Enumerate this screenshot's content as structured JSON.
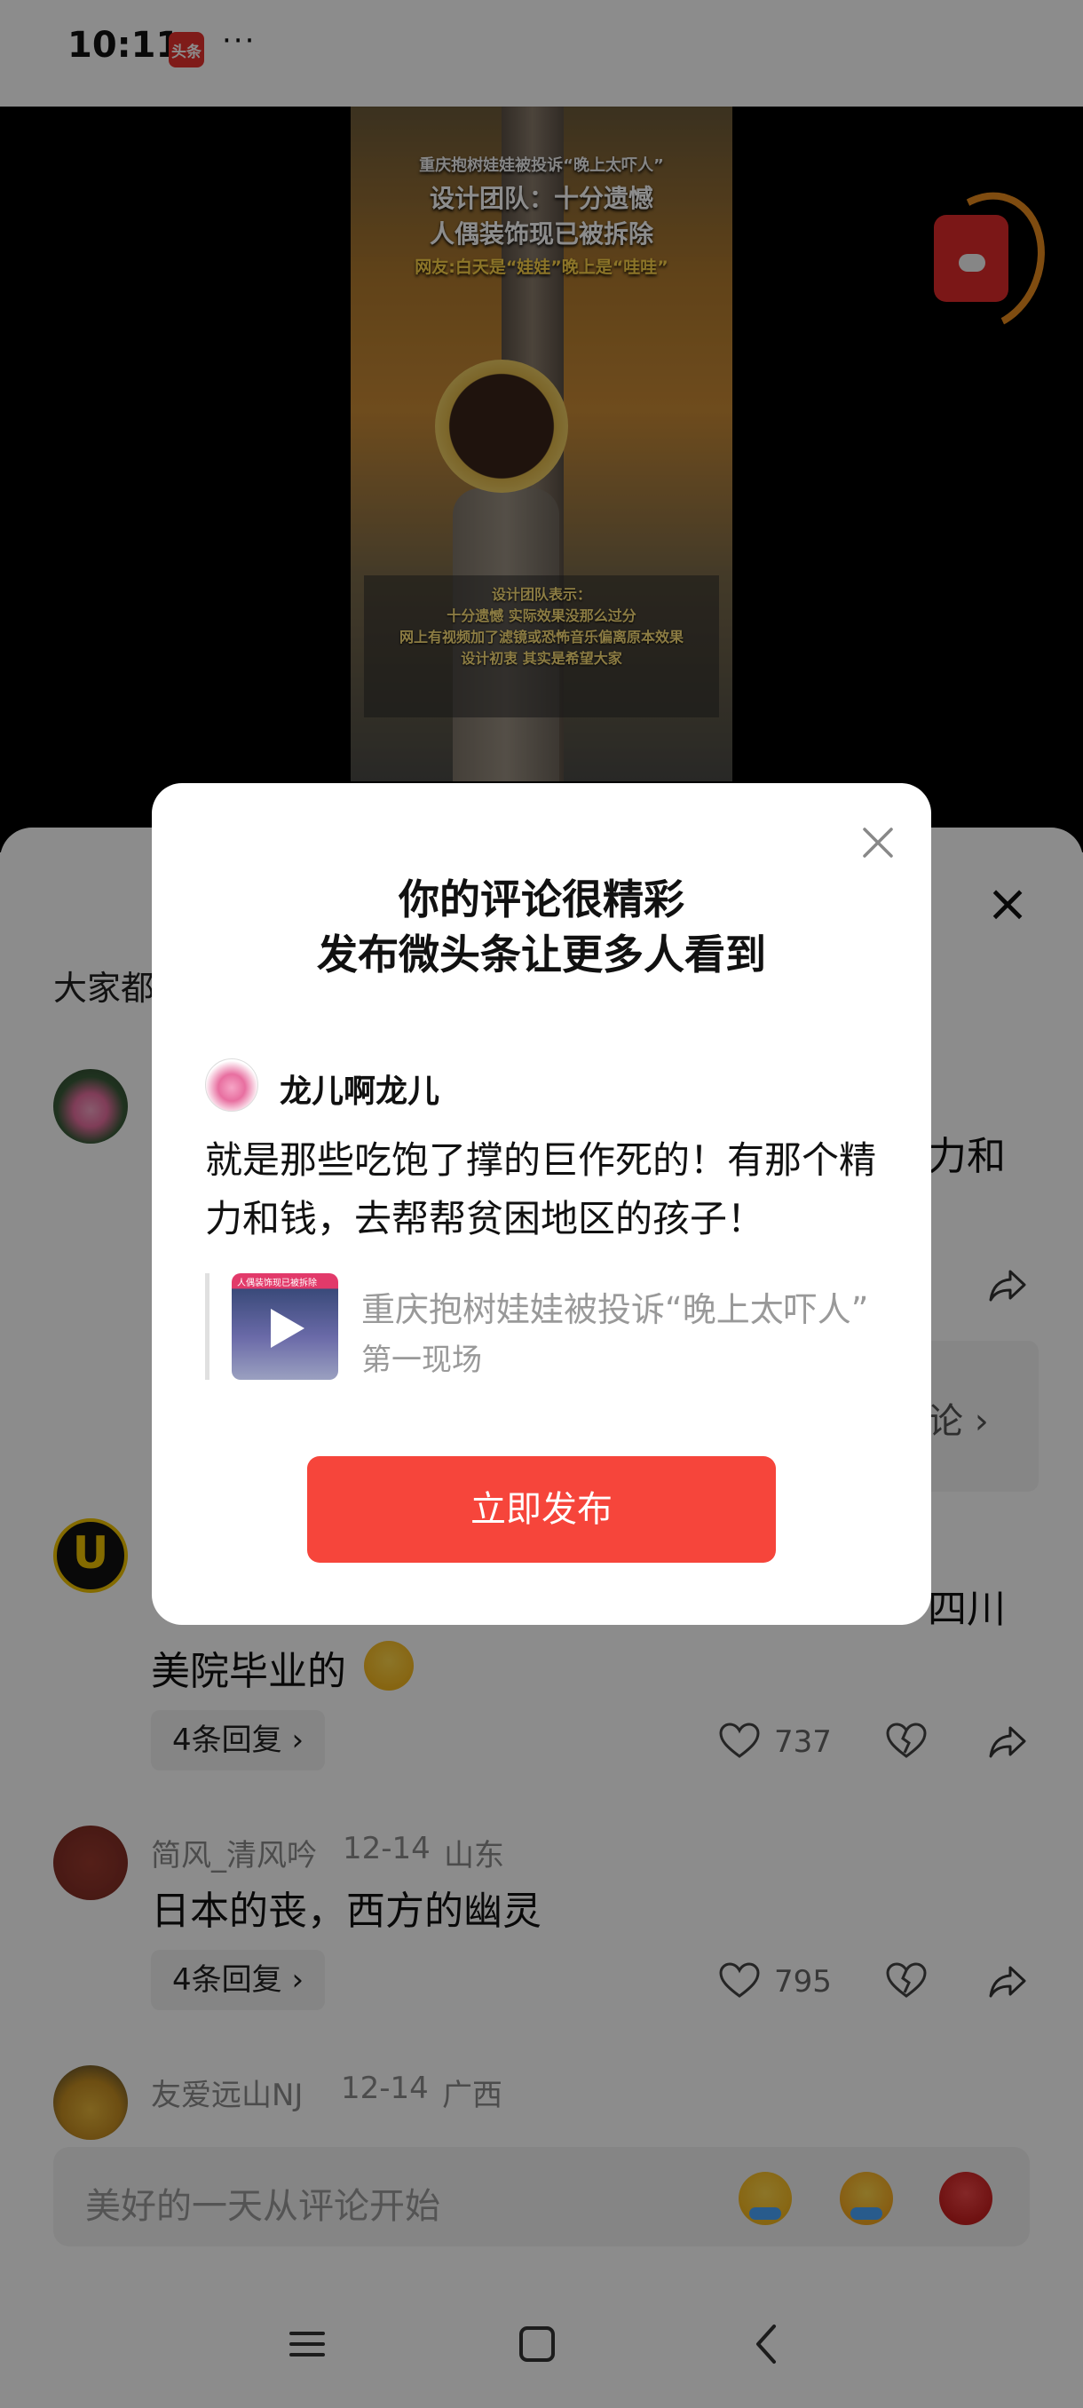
{
  "status_bar": {
    "time": "10:11",
    "app_badge": "头条",
    "overflow": "···"
  },
  "video": {
    "caption": [
      "重庆抱树娃娃被投诉“晚上太吓人”",
      "设计团队：十分遗憾",
      "人偶装饰现已被拆除",
      "网友:白天是“娃娃”晚上是“哇哇”"
    ],
    "note": [
      "设计团队表示：",
      "十分遗憾 实际效果没那么过分",
      "网上有视频加了滤镜或恐怖音乐偏离原本效果",
      "设计初衷 其实是希望大家"
    ]
  },
  "sheet": {
    "title": "大家都",
    "comments": [
      {
        "tail_line": "力和",
        "more_label": "论 ›"
      },
      {
        "text_tail": "四川",
        "text_line2": "美院毕业的",
        "reply_label": "4条回复 ›",
        "likes": "737"
      },
      {
        "author": "简风_清风吟",
        "date": "12-14",
        "region": "山东",
        "text": "日本的丧，西方的幽灵",
        "reply_label": "4条回复 ›",
        "likes": "795"
      },
      {
        "author": "友爱远山NJ",
        "date": "12-14",
        "region": "广西"
      }
    ],
    "input_placeholder": "美好的一天从评论开始",
    "icons": {
      "close": "close-icon",
      "like": "heart-icon",
      "dislike": "broken-heart-icon",
      "share": "share-icon"
    }
  },
  "dialog": {
    "title_line1": "你的评论很精彩",
    "title_line2": "发布微头条让更多人看到",
    "username": "龙儿啊龙儿",
    "comment": "就是那些吃饱了撑的巨作死的！有那个精力和钱，去帮帮贫困地区的孩子！",
    "quote_title": "重庆抱树娃娃被投诉“晚上太吓人”",
    "quote_source": "第一现场",
    "thumb_tag": "人偶装饰现已被拆除",
    "publish_label": "立即发布",
    "accent_color": "#f6453b"
  }
}
